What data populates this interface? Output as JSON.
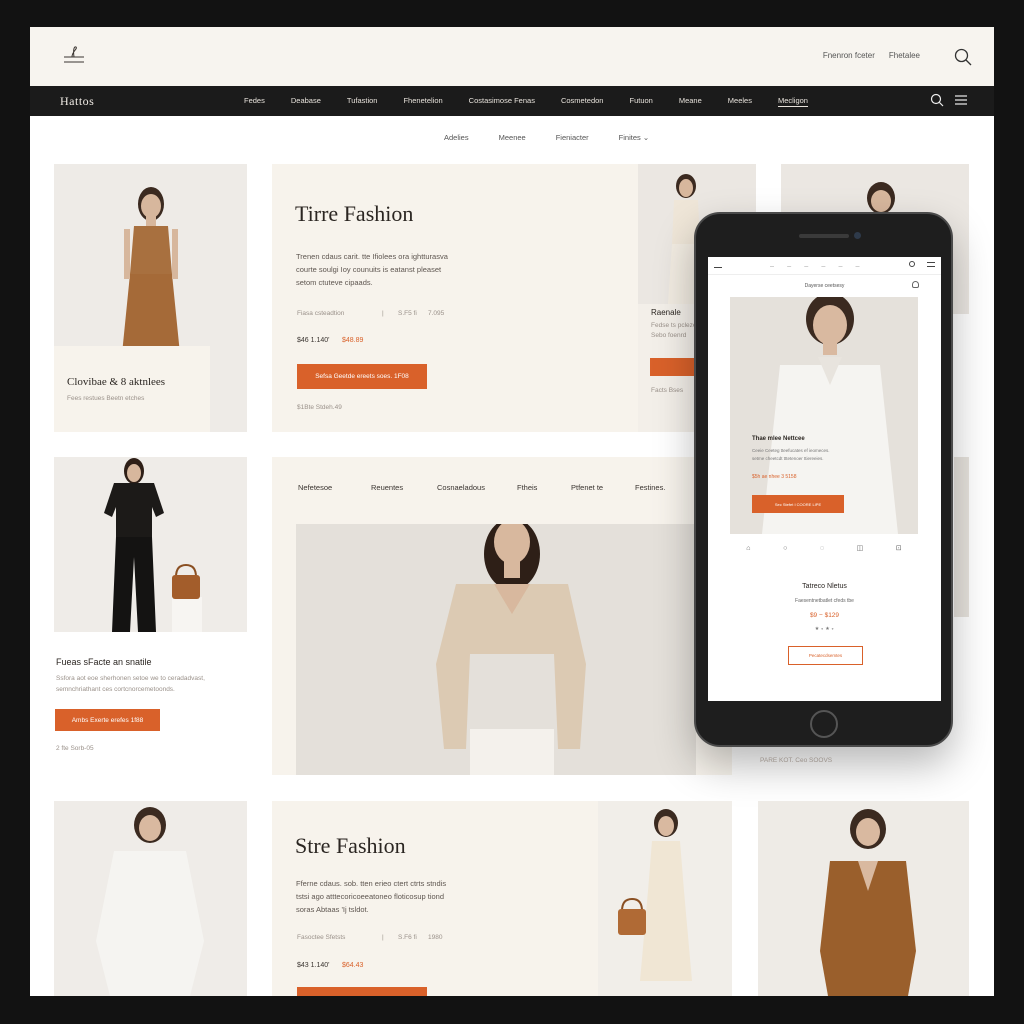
{
  "topbar": {
    "links": [
      "Fnenron fceter",
      "Fhetalee"
    ]
  },
  "nav": {
    "brand": "Hattos",
    "items": [
      "Fedes",
      "Deabase",
      "Tufastion",
      "Fhenetelion",
      "Costasimose Fenas",
      "Cosmetedon",
      "Futuon",
      "Meane",
      "Meeles",
      "Mecligon"
    ],
    "active_index": 9
  },
  "subnav": {
    "items": [
      "Adelies",
      "Meenee",
      "Fieniacter",
      "Finites"
    ]
  },
  "hero1": {
    "title": "Tirre Fashion",
    "desc": [
      "Trenen cdaus carit. tte Ifiolees ora ightturasva",
      "courte soulgi Ioy counuits is eatanst pleaset",
      "setom ctuteve cipaads."
    ],
    "meta": "Fiasa csteadtion",
    "meta_right": [
      "S.F5  fi",
      "7.095"
    ],
    "price_old": "$46  1.140'",
    "price_new": "$48.89",
    "button": "Sefsa  Geetde ereets soes.  1F08",
    "footnote": "$1Bte  Stdeh.49"
  },
  "card_left1": {
    "title": "Clovibae  & 8 aktnlees",
    "sub": "Fees restues   Beetn etches"
  },
  "card_right_partial": {
    "title": "Raenale",
    "sub": "Fedse ts pcleze",
    "sub2": "Sebo foenrd",
    "footnote": "Facts Bses"
  },
  "categories": [
    "Nefetesoe",
    "Reuentes",
    "Cosnaeladous",
    "Ftheis",
    "Ptfenet te",
    "Festines."
  ],
  "card_left2": {
    "title": "Fueas sFacte an snatile",
    "desc": [
      "Ssfora aot eoe sherhonen setoe we to ceradadvast,",
      "semnchriathant ces cortcnorcemetoonds."
    ],
    "button": "Ambs  Exerte erefes    1f88",
    "footnote": "2  fte  Sorb-05"
  },
  "phone": {
    "promo": "Dayerse ceetsesy",
    "overlay_title": "Thae mlee Nettcee",
    "overlay_desc": [
      "Ceeie Ceeteg tteefucates ef ieomeces.",
      "setme cheetcdt tttetenoer ttiereeies."
    ],
    "overlay_price": "$5h ae nhee 3 5158",
    "overlay_button": "Sec  Stefet  I COORE LIPE",
    "product_title": "Tatreco Nletus",
    "product_sub": "Faesentnetbatlet cfeds tbe",
    "product_price": "$9 − $129",
    "rating": "★  ∘ ★ ∘",
    "outline_button": "Pecatecdsemtes"
  },
  "below_phone": "PARE KOT.   Ceo SOOVS",
  "hero2": {
    "title": "Stre Fashion",
    "desc": [
      "Fferne cdaus. sob. tten erieo ctert ctrts stndis",
      "tstsi ago atttecoricoeeatoneo floticosup tiond",
      "soras Abtaas 'Ij tsldot."
    ],
    "meta": "Fasoctee Sfetsts",
    "meta_right": [
      "S.F6  fi",
      "1980"
    ],
    "price_old": "$43  1.140'",
    "price_new": "$64.43"
  },
  "colors": {
    "accent": "#d9612a",
    "nav_bg": "#1b1b1b",
    "panel": "#f7f3ec"
  }
}
